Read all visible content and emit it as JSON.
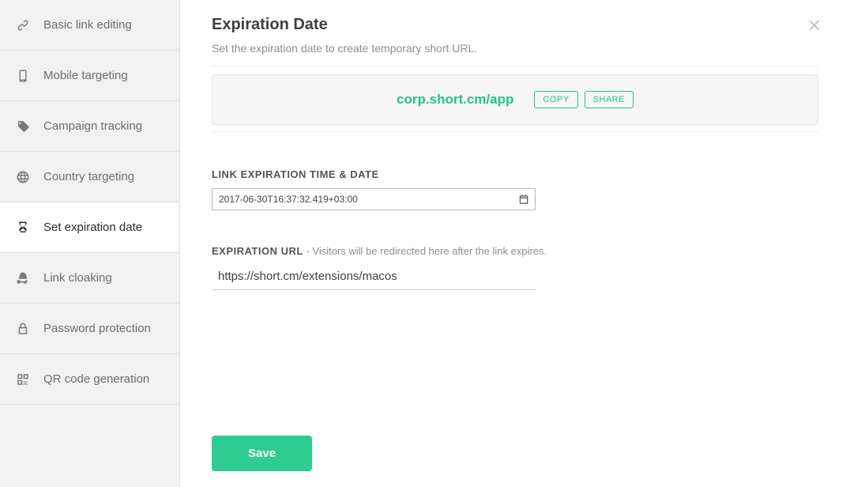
{
  "sidebar": {
    "items": [
      {
        "label": "Basic link editing"
      },
      {
        "label": "Mobile targeting"
      },
      {
        "label": "Campaign tracking"
      },
      {
        "label": "Country targeting"
      },
      {
        "label": "Set expiration date"
      },
      {
        "label": "Link cloaking"
      },
      {
        "label": "Password protection"
      },
      {
        "label": "QR code generation"
      }
    ]
  },
  "page": {
    "title": "Expiration Date",
    "subtitle": "Set the expiration date to create temporary short URL."
  },
  "url_card": {
    "short_url": "corp.short.cm/app",
    "copy_label": "COPY",
    "share_label": "SHARE"
  },
  "expiration_time": {
    "label": "LINK EXPIRATION TIME & DATE",
    "value": "2017-06-30T16:37:32.419+03:00"
  },
  "expiration_url": {
    "label": "EXPIRATION URL",
    "hint": " - Visitors will be redirected here after the link expires.",
    "value": "https://short.cm/extensions/macos"
  },
  "actions": {
    "save_label": "Save"
  },
  "colors": {
    "accent": "#25c08e",
    "button": "#2ecc91"
  }
}
